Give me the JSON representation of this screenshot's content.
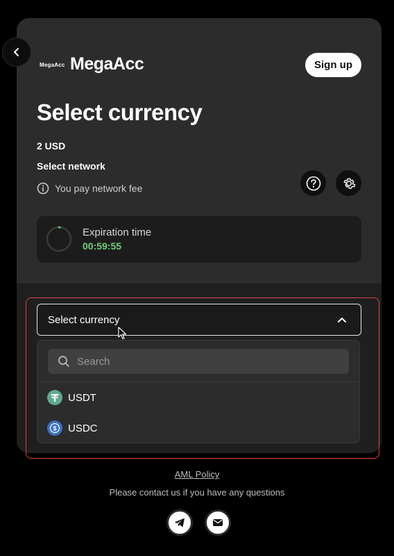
{
  "header": {
    "logo_small": "MegaAcc",
    "logo_text": "MegaAcc",
    "signup_label": "Sign up"
  },
  "main": {
    "title": "Select currency",
    "amount": "2 USD",
    "network_label": "Select network",
    "fee_note": "You pay network fee",
    "expiration_label": "Expiration time",
    "expiration_value": "00:59:55"
  },
  "currency_select": {
    "selected_value": "Select currency",
    "search_placeholder": "Search",
    "options": [
      {
        "label": "USDT",
        "icon": "tether-icon",
        "color": "#5fa992"
      },
      {
        "label": "USDC",
        "icon": "usdc-icon",
        "color": "#3b71c4"
      }
    ]
  },
  "footer": {
    "aml_link": "AML Policy",
    "contact_text": "Please contact us if you have any questions"
  },
  "colors": {
    "accent_green": "#6fcf75",
    "highlight_red": "#e0453a"
  }
}
